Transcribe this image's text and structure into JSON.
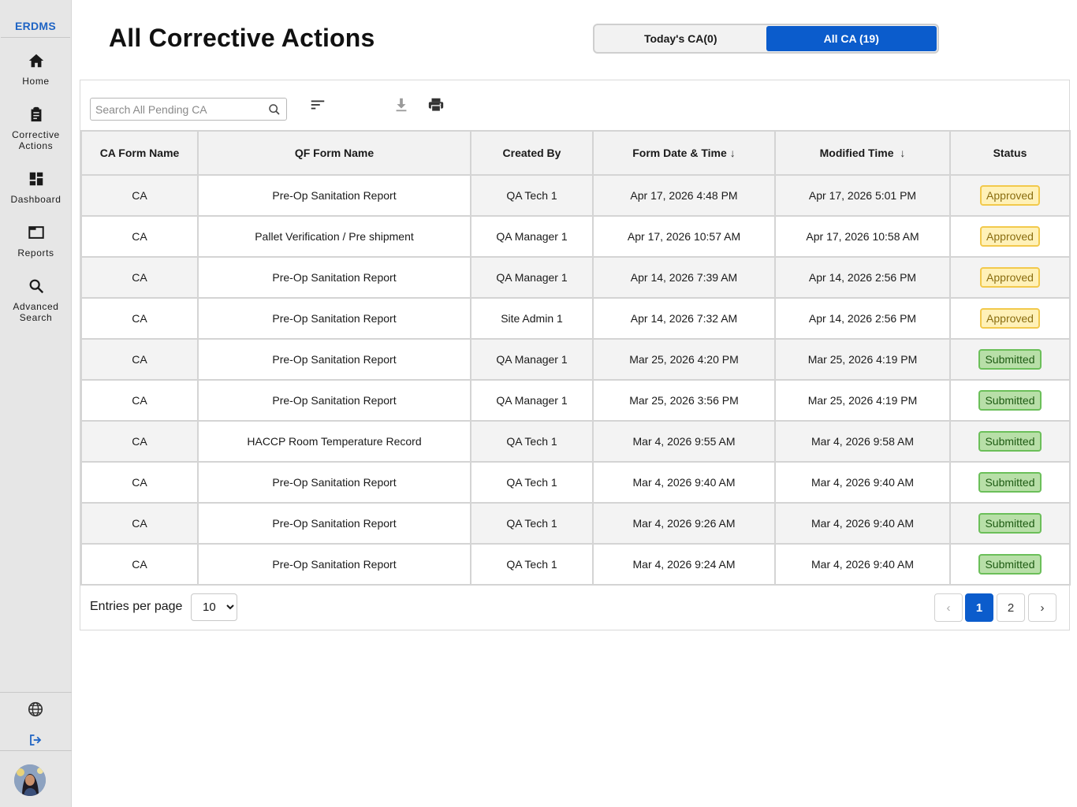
{
  "app": {
    "brand": "ERDMS"
  },
  "sidebar": {
    "items": [
      {
        "label": "Home",
        "icon": "home-icon"
      },
      {
        "label": "Corrective Actions",
        "icon": "clipboard-icon"
      },
      {
        "label": "Dashboard",
        "icon": "dashboard-icon"
      },
      {
        "label": "Reports",
        "icon": "reports-icon"
      },
      {
        "label": "Advanced Search",
        "icon": "search-icon"
      }
    ],
    "bottom_icons": [
      "globe-icon",
      "logout-icon"
    ],
    "accent": "#1f64c4"
  },
  "header": {
    "title": "All Corrective Actions",
    "tabs": [
      {
        "label": "Today's CA(0)",
        "active": false
      },
      {
        "label": "All CA (19)",
        "active": true
      }
    ]
  },
  "toolbar": {
    "search_placeholder": "Search All Pending CA",
    "search_value": ""
  },
  "table": {
    "columns": [
      "CA Form Name",
      "QF Form Name",
      "Created By",
      "Form Date & Time",
      "Modified Time",
      "Status"
    ],
    "sort_arrow": "↓",
    "rows": [
      {
        "ca": "CA",
        "qf": "Pre-Op Sanitation Report",
        "by": "QA Tech 1",
        "date": "Apr 17, 2026 4:48 PM",
        "modified": "Apr 17, 2026 5:01 PM",
        "status": "Approved"
      },
      {
        "ca": "CA",
        "qf": "Pallet Verification / Pre shipment",
        "by": "QA Manager 1",
        "date": "Apr 17, 2026 10:57 AM",
        "modified": "Apr 17, 2026 10:58 AM",
        "status": "Approved"
      },
      {
        "ca": "CA",
        "qf": "Pre-Op Sanitation Report",
        "by": "QA Manager 1",
        "date": "Apr 14, 2026 7:39 AM",
        "modified": "Apr 14, 2026 2:56 PM",
        "status": "Approved"
      },
      {
        "ca": "CA",
        "qf": "Pre-Op Sanitation Report",
        "by": "Site Admin 1",
        "date": "Apr 14, 2026 7:32 AM",
        "modified": "Apr 14, 2026 2:56 PM",
        "status": "Approved"
      },
      {
        "ca": "CA",
        "qf": "Pre-Op Sanitation Report",
        "by": "QA Manager 1",
        "date": "Mar 25, 2026 4:20 PM",
        "modified": "Mar 25, 2026 4:19 PM",
        "status": "Submitted"
      },
      {
        "ca": "CA",
        "qf": "Pre-Op Sanitation Report",
        "by": "QA Manager 1",
        "date": "Mar 25, 2026 3:56 PM",
        "modified": "Mar 25, 2026 4:19 PM",
        "status": "Submitted"
      },
      {
        "ca": "CA",
        "qf": "HACCP Room Temperature Record",
        "by": "QA Tech 1",
        "date": "Mar 4, 2026 9:55 AM",
        "modified": "Mar 4, 2026 9:58 AM",
        "status": "Submitted"
      },
      {
        "ca": "CA",
        "qf": "Pre-Op Sanitation Report",
        "by": "QA Tech 1",
        "date": "Mar 4, 2026 9:40 AM",
        "modified": "Mar 4, 2026 9:40 AM",
        "status": "Submitted"
      },
      {
        "ca": "CA",
        "qf": "Pre-Op Sanitation Report",
        "by": "QA Tech 1",
        "date": "Mar 4, 2026 9:26 AM",
        "modified": "Mar 4, 2026 9:40 AM",
        "status": "Submitted"
      },
      {
        "ca": "CA",
        "qf": "Pre-Op Sanitation Report",
        "by": "QA Tech 1",
        "date": "Mar 4, 2026 9:24 AM",
        "modified": "Mar 4, 2026 9:40 AM",
        "status": "Submitted"
      }
    ]
  },
  "footer": {
    "entries_label": "Entries per page",
    "entries_value": "10",
    "pages": [
      "1",
      "2"
    ],
    "current_page": "1",
    "prev": "‹",
    "next": "›"
  },
  "colors": {
    "primary": "#0b5ccc",
    "approved_bg": "#fff1b8",
    "approved_border": "#f2c94c",
    "submitted_bg": "#b8dfa8",
    "submitted_border": "#6bbf59"
  }
}
